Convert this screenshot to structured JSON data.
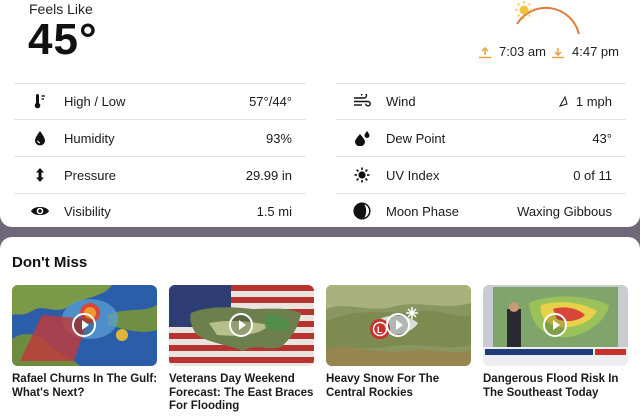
{
  "feels_like": {
    "label": "Feels Like",
    "value": "45°"
  },
  "sun": {
    "sunrise": "7:03 am",
    "sunset": "4:47 pm"
  },
  "details": [
    {
      "icon": "thermometer-icon",
      "label": "High / Low",
      "value": "57°/44°"
    },
    {
      "icon": "wind-icon",
      "label": "Wind",
      "value": "1 mph"
    },
    {
      "icon": "humidity-drop-icon",
      "label": "Humidity",
      "value": "93%"
    },
    {
      "icon": "dew-point-icon",
      "label": "Dew Point",
      "value": "43°"
    },
    {
      "icon": "pressure-icon",
      "label": "Pressure",
      "value": "29.99 in"
    },
    {
      "icon": "uv-sun-icon",
      "label": "UV Index",
      "value": "0 of 11"
    },
    {
      "icon": "visibility-eye-icon",
      "label": "Visibility",
      "value": "1.5 mi"
    },
    {
      "icon": "moon-phase-icon",
      "label": "Moon Phase",
      "value": "Waxing Gibbous"
    }
  ],
  "dont_miss": {
    "title": "Don't Miss",
    "videos": [
      {
        "title": "Rafael Churns In The Gulf: What's Next?"
      },
      {
        "title": "Veterans Day Weekend Forecast: The East Braces For Flooding"
      },
      {
        "title": "Heavy Snow For The Central Rockies"
      },
      {
        "title": "Dangerous Flood Risk In The Southeast Today"
      }
    ]
  },
  "colors": {
    "accent": "#e8a23a",
    "card_bg": "#ffffff",
    "page_bg": "#6e6878",
    "divider": "#e3e3e3"
  }
}
